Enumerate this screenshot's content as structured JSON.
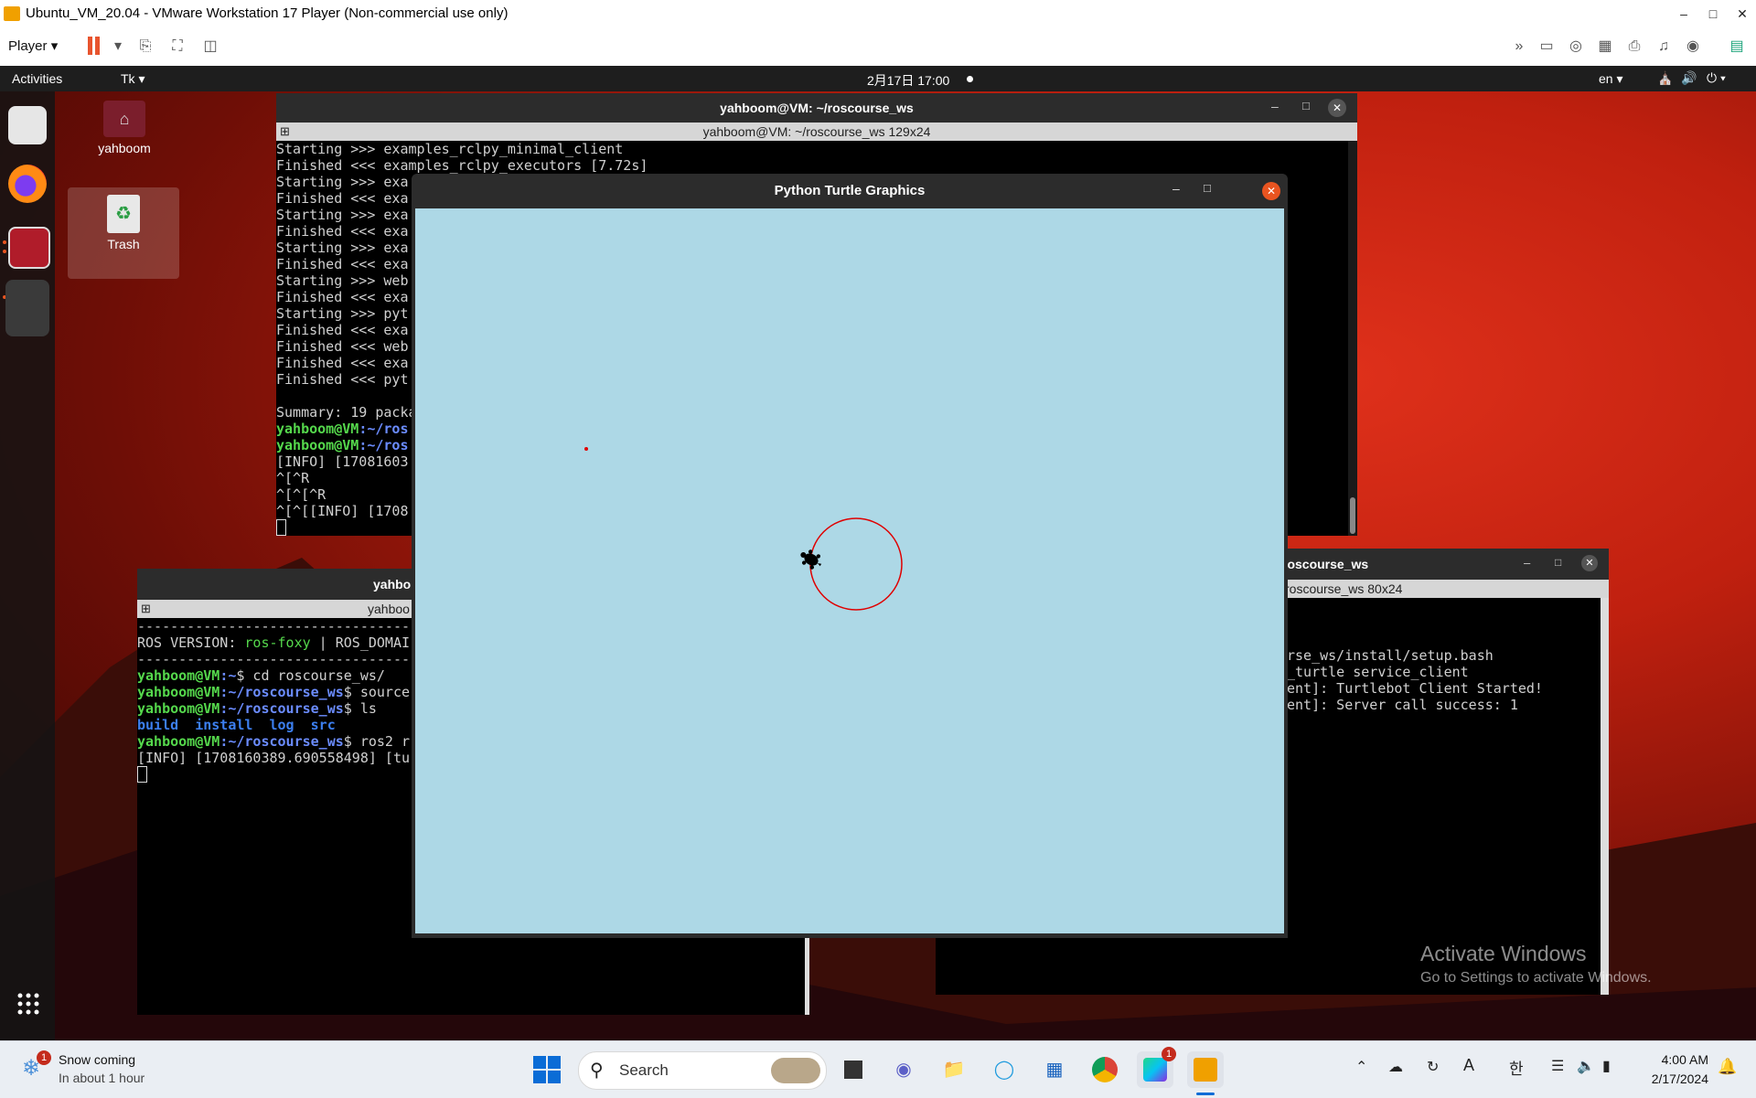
{
  "vmware": {
    "title": "Ubuntu_VM_20.04 - VMware Workstation 17 Player (Non-commercial use only)",
    "player_menu": "Player"
  },
  "ubuntu": {
    "activities": "Activities",
    "app_menu": "Tk",
    "clock": "2月17日  17:00",
    "lang": "en",
    "desktop_icons": [
      {
        "label": "yahboom",
        "icon": "home-folder-icon"
      },
      {
        "label": "Trash",
        "icon": "trash-icon"
      }
    ]
  },
  "term_top": {
    "title": "yahboom@VM: ~/roscourse_ws",
    "tab": "yahboom@VM: ~/roscourse_ws 129x24",
    "lines": [
      "Starting >>> examples_rclpy_minimal_client",
      "Finished <<< examples_rclpy_executors [7.72s]",
      "Starting >>> exa",
      "Finished <<< exa",
      "Starting >>> exa",
      "Finished <<< exa",
      "Starting >>> exa",
      "Finished <<< exa",
      "Starting >>> web",
      "Finished <<< exa",
      "Starting >>> pyt",
      "Finished <<< exa",
      "Finished <<< web",
      "Finished <<< exa",
      "Finished <<< pyt",
      "",
      "Summary: 19 packa",
      "",
      "",
      "[INFO] [17081603",
      "^[^R",
      "^[^[^R",
      "^[^[[INFO] [1708"
    ],
    "prompt_user": "yahboom@VM",
    "prompt_path_a": ":~/ros",
    "prompt_path_b": ":~/ros"
  },
  "term_left": {
    "title": "yahbo",
    "tab": "yahboo",
    "divider": "---------------------------------------------",
    "ros_version_label": "ROS VERSION: ",
    "ros_version": "ros-foxy",
    "ros_domain": " | ROS_DOMAI",
    "divider2": "---------------------------------------------",
    "user": "yahboom@VM",
    "cmd1_path": ":~",
    "cmd1": "$ cd roscourse_ws/",
    "cmd2_path": ":~/roscourse_ws",
    "cmd2": "$ source",
    "cmd3_path": ":~/roscourse_ws",
    "cmd3": "$ ls",
    "ls_build": "build",
    "ls_install": "install",
    "ls_log": "log",
    "ls_src": "src",
    "cmd4_path": ":~/roscourse_ws",
    "cmd4": "$ ros2 r",
    "info": "[INFO] [1708160389.690558498] [tu"
  },
  "term_right": {
    "title": "roscourse_ws",
    "tab": "roscourse_ws 80x24",
    "lines": [
      "",
      "",
      "",
      "rse_ws/install/setup.bash",
      "_turtle service_client",
      "ent]: Turtlebot Client Started!",
      "ent]: Server call success: 1"
    ]
  },
  "turtle": {
    "title": "Python Turtle Graphics",
    "bg_color": "#add8e6",
    "pen_color": "#e00000"
  },
  "watermark": {
    "line1": "Activate Windows",
    "line2": "Go to Settings to activate Windows."
  },
  "taskbar": {
    "weather_title": "Snow coming",
    "weather_sub": "In about 1 hour",
    "weather_badge": "1",
    "search": "Search",
    "time": "4:00 AM",
    "date": "2/17/2024",
    "app_badge": "1"
  }
}
